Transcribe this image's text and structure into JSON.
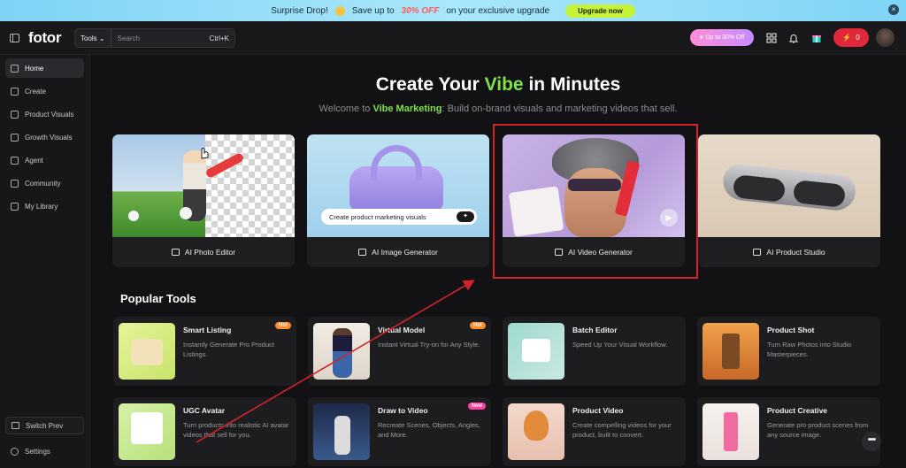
{
  "banner": {
    "text_a": "Surprise Drop!",
    "text_b": "Save up to",
    "highlight": "30% OFF",
    "text_c": "on your exclusive upgrade",
    "button": "Upgrade now"
  },
  "topbar": {
    "logo": "fotor",
    "search_tools": "Tools",
    "search_placeholder": "Search",
    "shortcut": "Ctrl+K",
    "promo": "Up to 30% Off",
    "credits": "0"
  },
  "sidebar": {
    "items": [
      "Home",
      "Create",
      "Product Visuals",
      "Growth Visuals",
      "Agent",
      "Community",
      "My Library"
    ],
    "switch": "Switch Prev",
    "settings": "Settings"
  },
  "hero": {
    "a": "Create Your ",
    "vibe": "Vibe",
    "b": " in Minutes",
    "sub_pre": "Welcome to ",
    "sub_brand": "Vibe Marketing",
    "sub_post": ": Build on-brand visuals and marketing videos that sell."
  },
  "cards": [
    {
      "label": "AI Photo Editor"
    },
    {
      "label": "AI Image Generator",
      "overlay": "Create product marketing visuals"
    },
    {
      "label": "AI Video Generator"
    },
    {
      "label": "AI Product Studio"
    }
  ],
  "popular": {
    "title": "Popular Tools",
    "tools": [
      {
        "title": "Smart Listing",
        "desc": "Instantly Generate Pro Product Listings.",
        "badge": "Hot"
      },
      {
        "title": "Virtual Model",
        "desc": "Instant Virtual Try-on for Any Style.",
        "badge": "Hot"
      },
      {
        "title": "Batch Editor",
        "desc": "Speed Up Your Visual Workflow.",
        "badge": ""
      },
      {
        "title": "Product Shot",
        "desc": "Turn Raw Photos into Studio Masterpieces.",
        "badge": ""
      },
      {
        "title": "UGC Avatar",
        "desc": "Turn products into realistic AI avatar videos that sell for you.",
        "badge": ""
      },
      {
        "title": "Draw to Video",
        "desc": "Recreate Scenes, Objects, Angles, and More.",
        "badge": "New"
      },
      {
        "title": "Product Video",
        "desc": "Create compelling videos for your product, built to convert.",
        "badge": ""
      },
      {
        "title": "Product Creative",
        "desc": "Generate pro product scenes from any source image.",
        "badge": ""
      }
    ]
  },
  "colors": {
    "accent_green": "#7ee04b",
    "highlight_red": "#d2232a",
    "credit_red": "#e0283a"
  }
}
